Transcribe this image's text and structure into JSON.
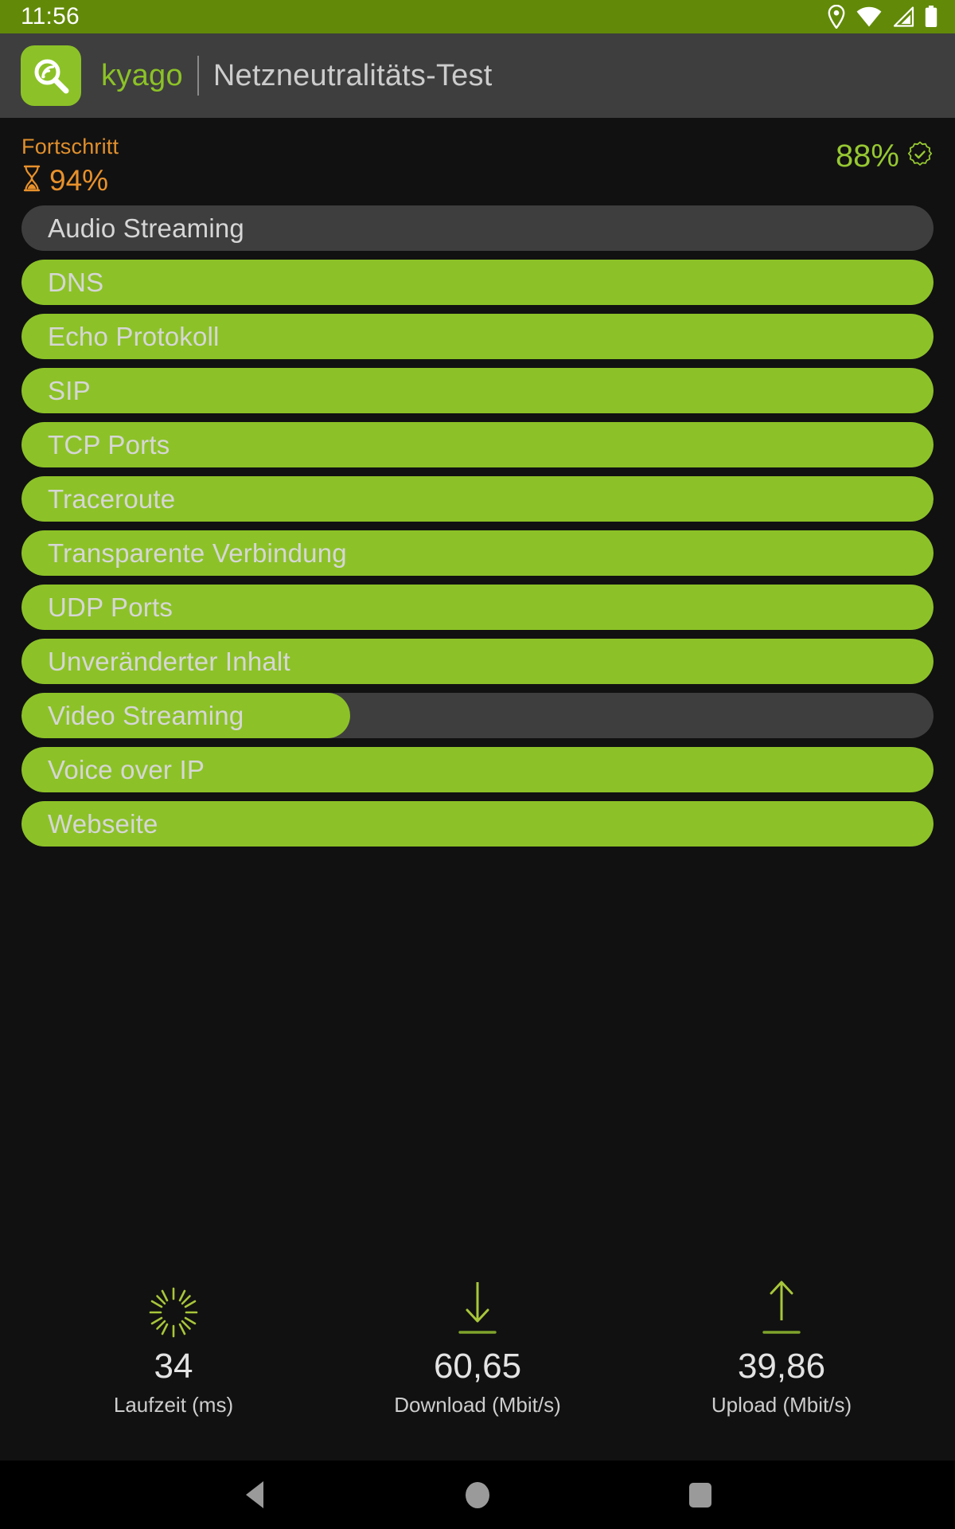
{
  "statusbar": {
    "time": "11:56",
    "icons": [
      "location-pin-icon",
      "wifi-icon",
      "cellular-signal-icon",
      "battery-icon"
    ]
  },
  "appbar": {
    "logo_icon": "kyago-magnifier-signal-icon",
    "brand": "kyago",
    "title": "Netzneutralitäts-Test"
  },
  "progress": {
    "label": "Fortschritt",
    "hourglass_icon": "hourglass-icon",
    "percent": "94%",
    "score": "88%",
    "score_icon": "verified-badge-icon"
  },
  "tests": [
    {
      "label": "Audio Streaming",
      "fill_percent": 0
    },
    {
      "label": "DNS",
      "fill_percent": 100
    },
    {
      "label": "Echo Protokoll",
      "fill_percent": 100
    },
    {
      "label": "SIP",
      "fill_percent": 100
    },
    {
      "label": "TCP Ports",
      "fill_percent": 100
    },
    {
      "label": "Traceroute",
      "fill_percent": 100
    },
    {
      "label": "Transparente Verbindung",
      "fill_percent": 100
    },
    {
      "label": "UDP Ports",
      "fill_percent": 100
    },
    {
      "label": "Unveränderter Inhalt",
      "fill_percent": 100
    },
    {
      "label": "Video Streaming",
      "fill_percent": 36
    },
    {
      "label": "Voice over IP",
      "fill_percent": 100
    },
    {
      "label": "Webseite",
      "fill_percent": 100
    }
  ],
  "stats": [
    {
      "icon": "latency-starburst-icon",
      "value": "34",
      "caption": "Laufzeit (ms)"
    },
    {
      "icon": "download-arrow-icon",
      "value": "60,65",
      "caption": "Download (Mbit/s)"
    },
    {
      "icon": "upload-arrow-icon",
      "value": "39,86",
      "caption": "Upload (Mbit/s)"
    }
  ],
  "navbar": {
    "back": "back-button",
    "home": "home-button",
    "recents": "recents-button"
  },
  "colors": {
    "statusbar_green": "#628A08",
    "accent_green": "#8CC227",
    "score_green": "#96C832",
    "progress_orange": "#E8912B",
    "appbar_gray": "#3E3E3E",
    "track_gray": "#3E3E3E",
    "background": "#111111"
  }
}
